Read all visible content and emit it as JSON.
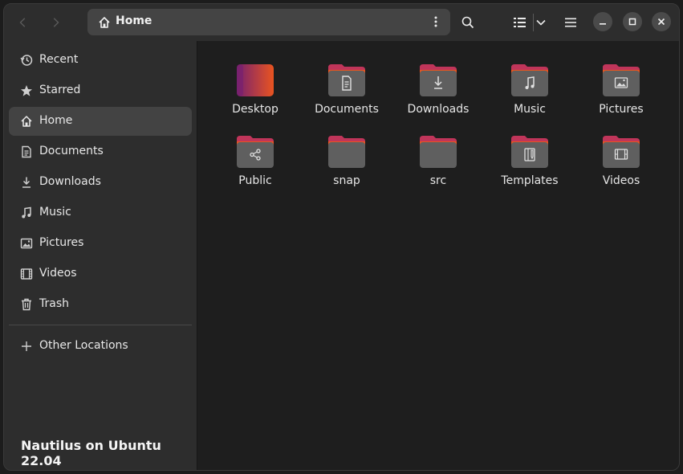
{
  "headerbar": {
    "path": {
      "label": "Home",
      "icon": "home-icon"
    }
  },
  "sidebar": {
    "items": [
      {
        "label": "Recent",
        "icon": "clock-icon"
      },
      {
        "label": "Starred",
        "icon": "star-icon"
      },
      {
        "label": "Home",
        "icon": "home-icon",
        "active": true
      },
      {
        "label": "Documents",
        "icon": "document-icon"
      },
      {
        "label": "Downloads",
        "icon": "download-icon"
      },
      {
        "label": "Music",
        "icon": "music-icon"
      },
      {
        "label": "Pictures",
        "icon": "picture-icon"
      },
      {
        "label": "Videos",
        "icon": "video-icon"
      },
      {
        "label": "Trash",
        "icon": "trash-icon"
      }
    ],
    "other_locations": {
      "label": "Other Locations",
      "icon": "plus-icon"
    },
    "footer": "Nautilus on Ubuntu 22.04"
  },
  "content": {
    "items": [
      {
        "label": "Desktop",
        "icon": "desktop-folder-icon"
      },
      {
        "label": "Documents",
        "icon": "documents-folder-icon"
      },
      {
        "label": "Downloads",
        "icon": "downloads-folder-icon"
      },
      {
        "label": "Music",
        "icon": "music-folder-icon"
      },
      {
        "label": "Pictures",
        "icon": "pictures-folder-icon"
      },
      {
        "label": "Public",
        "icon": "public-folder-icon"
      },
      {
        "label": "snap",
        "icon": "folder-icon"
      },
      {
        "label": "src",
        "icon": "folder-icon"
      },
      {
        "label": "Templates",
        "icon": "templates-folder-icon"
      },
      {
        "label": "Videos",
        "icon": "videos-folder-icon"
      }
    ]
  },
  "colors": {
    "accent_top": "#e95420",
    "accent_bottom": "#77216f",
    "folder_body": "#5f5f5f",
    "selection": "#434343"
  }
}
